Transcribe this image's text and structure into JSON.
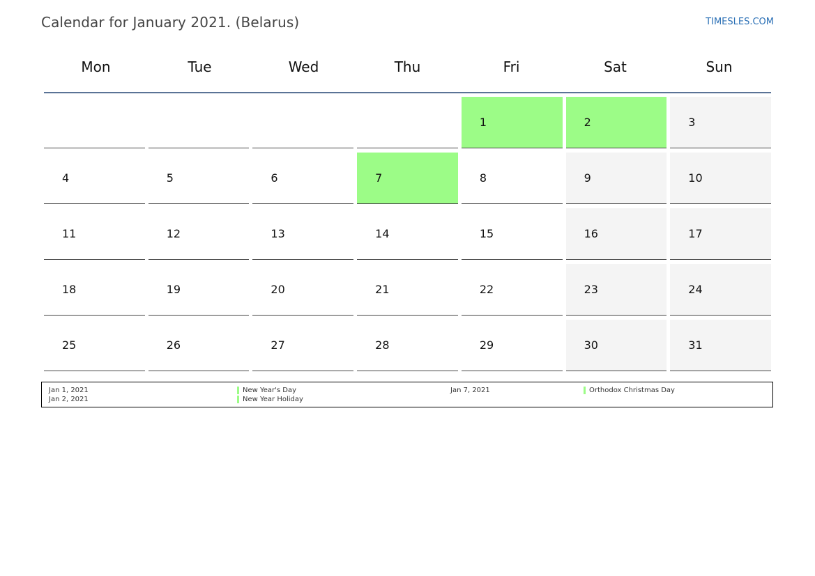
{
  "header": {
    "title": "Calendar for January 2021. (Belarus)",
    "site": "TIMESLES.COM"
  },
  "colors": {
    "holiday": "#9cfc87",
    "weekend": "#f4f4f4",
    "header_line": "#5a7396",
    "link": "#2a6fb5"
  },
  "weekdays": [
    "Mon",
    "Tue",
    "Wed",
    "Thu",
    "Fri",
    "Sat",
    "Sun"
  ],
  "weeks": [
    [
      "",
      "",
      "",
      "",
      "1",
      "2",
      "3"
    ],
    [
      "4",
      "5",
      "6",
      "7",
      "8",
      "9",
      "10"
    ],
    [
      "11",
      "12",
      "13",
      "14",
      "15",
      "16",
      "17"
    ],
    [
      "18",
      "19",
      "20",
      "21",
      "22",
      "23",
      "24"
    ],
    [
      "25",
      "26",
      "27",
      "28",
      "29",
      "30",
      "31"
    ]
  ],
  "holiday_days": [
    "1",
    "2",
    "7"
  ],
  "legend": [
    {
      "date": "Jan 1, 2021",
      "name": "New Year's Day"
    },
    {
      "date": "Jan 2, 2021",
      "name": "New Year Holiday"
    },
    {
      "date": "Jan 7, 2021",
      "name": "Orthodox Christmas Day"
    }
  ]
}
